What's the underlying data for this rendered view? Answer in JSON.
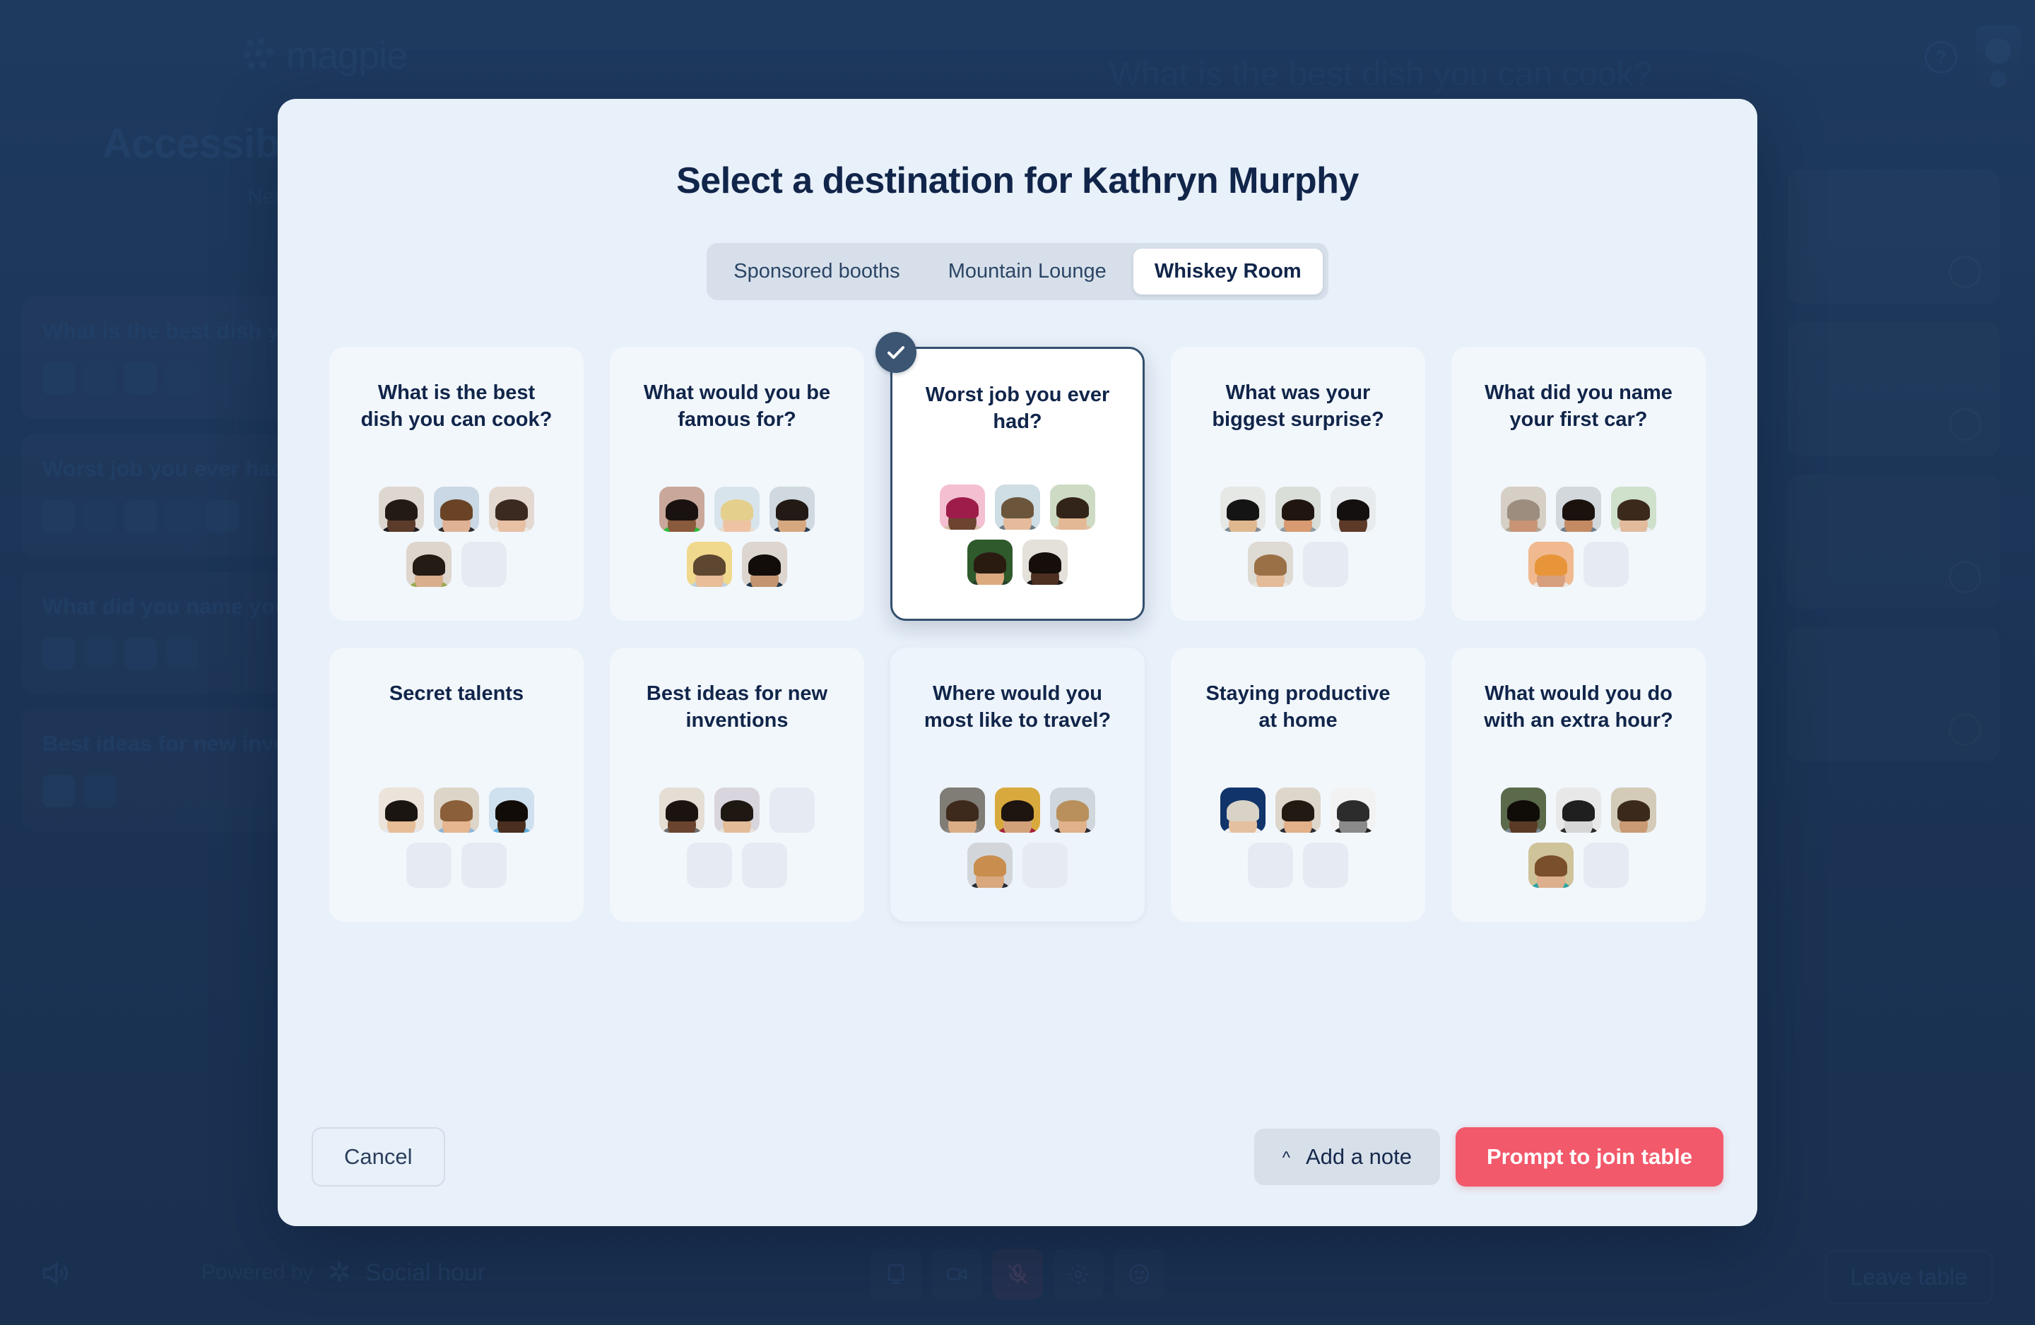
{
  "background": {
    "logo_text": "magpie",
    "page_heading": "Accessibility",
    "page_sub": "Net",
    "room_title": "What is the best dish you can cook?",
    "help_icon": "question-mark-icon",
    "questions": [
      {
        "title": "What is the best dish you can cook?",
        "avatar_count": 4
      },
      {
        "title": "Worst job you ever had?",
        "avatar_count": 5
      },
      {
        "title": "What did you name your first car?",
        "avatar_count": 4
      },
      {
        "title": "Best ideas for new inventions",
        "avatar_count": 2
      }
    ],
    "bottombar": {
      "speaker_icon": "speaker-icon",
      "powered_by_label": "Powered by",
      "brand_name": "Social hour",
      "controls": [
        {
          "icon": "screen-share-icon",
          "state": "normal"
        },
        {
          "icon": "video-camera-icon",
          "state": "normal"
        },
        {
          "icon": "microphone-muted-icon",
          "state": "muted"
        },
        {
          "icon": "gear-icon",
          "state": "normal"
        },
        {
          "icon": "emoji-icon",
          "state": "normal"
        }
      ],
      "leave_label": "Leave table"
    }
  },
  "modal": {
    "title": "Select a destination for Kathryn Murphy",
    "tabs": [
      {
        "label": "Sponsored booths",
        "active": false
      },
      {
        "label": "Mountain Lounge",
        "active": false
      },
      {
        "label": "Whiskey Room",
        "active": true
      }
    ],
    "cards": [
      {
        "title": "What is the best dish you can cook?",
        "selected": false,
        "hovered": false,
        "avatars": [
          {
            "bg": "#ded7d0",
            "skin": "#5c3b2b",
            "hair": "#241a14",
            "body": "#1d1d22"
          },
          {
            "bg": "#c9d8e4",
            "skin": "#e0b295",
            "hair": "#6a4326",
            "body": "#2e2a2c"
          },
          {
            "bg": "#e3d9d1",
            "skin": "#e8c0a4",
            "hair": "#3a2a20",
            "body": "#ece8e4"
          },
          {
            "bg": "#ded6cd",
            "skin": "#d8ae8c",
            "hair": "#241b15",
            "body": "#9aa84e"
          }
        ],
        "empty_slots": 1
      },
      {
        "title": "What would you be famous for?",
        "selected": false,
        "hovered": false,
        "avatars": [
          {
            "bg": "#c9a89b",
            "skin": "#8a5a3c",
            "hair": "#1a1210",
            "body": "#2bbd3a"
          },
          {
            "bg": "#d8e4ec",
            "skin": "#edc3a4",
            "hair": "#e4cf8c",
            "body": "#e9dccf"
          },
          {
            "bg": "#cfd9df",
            "skin": "#d6a87f",
            "hair": "#231a15",
            "body": "#2d3d52"
          },
          {
            "bg": "#f0d98c",
            "skin": "#e8bd98",
            "hair": "#5e4730",
            "body": "#bcd0e0"
          },
          {
            "bg": "#dcd6cf",
            "skin": "#c49470",
            "hair": "#120d0a",
            "body": "#20344a"
          }
        ],
        "empty_slots": 0
      },
      {
        "title": "Worst job you ever had?",
        "selected": true,
        "hovered": false,
        "avatars": [
          {
            "bg": "#f4bfd0",
            "skin": "#6d4430",
            "hair": "#9e1c4a",
            "body": "#d8c0ad"
          },
          {
            "bg": "#cfdde4",
            "skin": "#e5bb9b",
            "hair": "#6b563c",
            "body": "#6c7c86"
          },
          {
            "bg": "#cedbc4",
            "skin": "#e3b894",
            "hair": "#33241a",
            "body": "#e2c0a4"
          },
          {
            "bg": "#2f5a2c",
            "skin": "#dca97f",
            "hair": "#2a1b11",
            "body": "#25402a"
          },
          {
            "bg": "#e4e0da",
            "skin": "#4e3021",
            "hair": "#150e0a",
            "body": "#191919"
          }
        ],
        "empty_slots": 0
      },
      {
        "title": "What was your biggest surprise?",
        "selected": false,
        "hovered": false,
        "avatars": [
          {
            "bg": "#e6e8e6",
            "skin": "#e0b88f",
            "hair": "#141414",
            "body": "#7f8b94"
          },
          {
            "bg": "#d9ded8",
            "skin": "#d79a71",
            "hair": "#211510",
            "body": "#8e9aa2"
          },
          {
            "bg": "#e8ebed",
            "skin": "#5d3a27",
            "hair": "#151010",
            "body": "#e7e9ea"
          },
          {
            "bg": "#dedad4",
            "skin": "#e3bb98",
            "hair": "#9a7147",
            "body": "#e8e6e2"
          }
        ],
        "empty_slots": 1
      },
      {
        "title": "What did you name your first car?",
        "selected": false,
        "hovered": false,
        "avatars": [
          {
            "bg": "#d6cfc6",
            "skin": "#c89474",
            "hair": "#9c8d7e",
            "body": "#b0a495"
          },
          {
            "bg": "#d3d8dd",
            "skin": "#c48b63",
            "hair": "#1b120d",
            "body": "#6e7c88"
          },
          {
            "bg": "#cfe0cb",
            "skin": "#e2bb9c",
            "hair": "#3b2a1c",
            "body": "#e9edf0"
          },
          {
            "bg": "#f0b98f",
            "skin": "#d89f7e",
            "hair": "#e8953a",
            "body": "#eae6e2"
          }
        ],
        "empty_slots": 1
      },
      {
        "title": "Secret talents",
        "selected": false,
        "hovered": false,
        "avatars": [
          {
            "bg": "#ece3da",
            "skin": "#e5bd96",
            "hair": "#1b1512",
            "body": "#e4e6e9"
          },
          {
            "bg": "#ddd5c8",
            "skin": "#e5b68f",
            "hair": "#8a5f39",
            "body": "#8fb6d8"
          },
          {
            "bg": "#cfe0ef",
            "skin": "#4a2e1f",
            "hair": "#120c08",
            "body": "#63b0e0"
          }
        ],
        "empty_slots": 2
      },
      {
        "title": "Best ideas for new inventions",
        "selected": false,
        "hovered": false,
        "avatars": [
          {
            "bg": "#e4ded5",
            "skin": "#6b4430",
            "hair": "#1a1310",
            "body": "#6d6d6d"
          },
          {
            "bg": "#d9d5de",
            "skin": "#e2bb98",
            "hair": "#1e1712",
            "body": "#e8e2da"
          }
        ],
        "empty_slots": 3
      },
      {
        "title": "Where would you most like to travel?",
        "selected": false,
        "hovered": true,
        "avatars": [
          {
            "bg": "#807c76",
            "skin": "#dcae86",
            "hair": "#3e2a1c",
            "body": "#8d8782"
          },
          {
            "bg": "#d8a93c",
            "skin": "#d3a179",
            "hair": "#1e1410",
            "body": "#a3213b"
          },
          {
            "bg": "#cfd7dc",
            "skin": "#e0b18a",
            "hair": "#b9905c",
            "body": "#2a2a30"
          },
          {
            "bg": "#d2d6da",
            "skin": "#d9a87f",
            "hair": "#c98e4e",
            "body": "#262a33"
          }
        ],
        "empty_slots": 1
      },
      {
        "title": "Staying productive at home",
        "selected": false,
        "hovered": false,
        "avatars": [
          {
            "bg": "#11346b",
            "skin": "#e5c0a0",
            "hair": "#d8d3c6",
            "body": "#f0f2f4"
          },
          {
            "bg": "#ddd6cb",
            "skin": "#e2b089",
            "hair": "#231913",
            "body": "#2a2c34"
          },
          {
            "bg": "#f2f2f2",
            "skin": "#8a8a8a",
            "hair": "#2c2c2c",
            "body": "#232323"
          }
        ],
        "empty_slots": 2
      },
      {
        "title": "What would you do with an extra hour?",
        "selected": false,
        "hovered": false,
        "avatars": [
          {
            "bg": "#5a6a4a",
            "skin": "#5a3a25",
            "hair": "#100c08",
            "body": "#7b8a96"
          },
          {
            "bg": "#e8e8e8",
            "skin": "#d6d6d6",
            "hair": "#1f1f1f",
            "body": "#2a2a2a"
          },
          {
            "bg": "#d3cbb7",
            "skin": "#c99a74",
            "hair": "#3b2a1c",
            "body": "#d6cdb8"
          },
          {
            "bg": "#cfc39a",
            "skin": "#dcb08c",
            "hair": "#7a4f2c",
            "body": "#2aa3a3"
          }
        ],
        "empty_slots": 1
      }
    ],
    "footer": {
      "cancel_label": "Cancel",
      "add_note_label": "Add a note",
      "add_note_icon": "chevron-up-icon",
      "prompt_label": "Prompt to join table"
    }
  },
  "colors": {
    "accent_red": "#f2596b",
    "modal_bg": "#e8f0f9",
    "card_bg": "#f2f7fc",
    "navy": "#11254a",
    "app_bg": "#1d3557",
    "selected_border": "#33506e"
  }
}
